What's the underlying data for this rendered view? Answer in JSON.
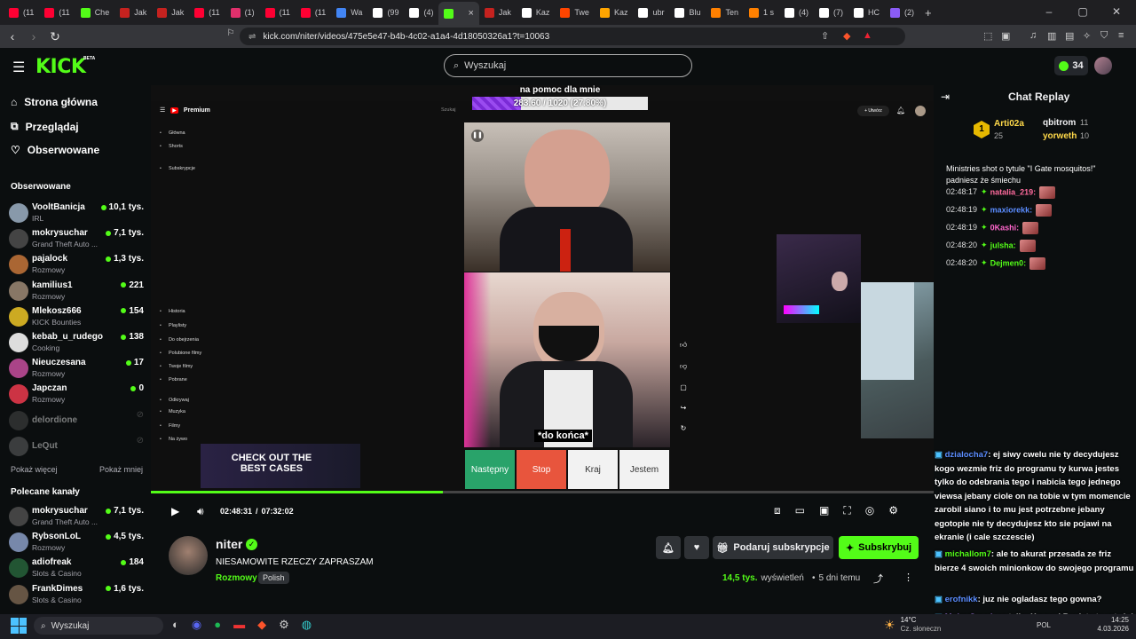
{
  "browser": {
    "tabs": [
      {
        "label": "(11",
        "color": "#ff0033"
      },
      {
        "label": "(11",
        "color": "#ff0033"
      },
      {
        "label": "Che",
        "color": "#53fc18"
      },
      {
        "label": "Jak",
        "color": "#c5221f"
      },
      {
        "label": "Jak",
        "color": "#c5221f"
      },
      {
        "label": "(11",
        "color": "#ff0033"
      },
      {
        "label": "(1)",
        "color": "#e1306c"
      },
      {
        "label": "(11",
        "color": "#ff0033"
      },
      {
        "label": "(11",
        "color": "#ff0033"
      },
      {
        "label": "Wa",
        "color": "#4285f4"
      },
      {
        "label": "(99",
        "color": "#ffffff"
      },
      {
        "label": "(4)",
        "color": "#ffffff"
      },
      {
        "label": "",
        "color": "#53fc18",
        "active": true
      },
      {
        "label": "Jak",
        "color": "#c5221f"
      },
      {
        "label": "Kaz",
        "color": "#ffffff"
      },
      {
        "label": "Twe",
        "color": "#ff4500"
      },
      {
        "label": "Kaz",
        "color": "#ffa500"
      },
      {
        "label": "ubr",
        "color": "#ffffff"
      },
      {
        "label": "Blu",
        "color": "#ffffff"
      },
      {
        "label": "Ten",
        "color": "#ff8000"
      },
      {
        "label": "1 s",
        "color": "#ff8000"
      },
      {
        "label": "(4)",
        "color": "#ffffff"
      },
      {
        "label": "(7)",
        "color": "#ffffff"
      },
      {
        "label": "HC",
        "color": "#ffffff"
      },
      {
        "label": "(2)",
        "color": "#8b5cf6"
      }
    ],
    "close_tab": "×",
    "new_tab": "+",
    "url": "kick.com/niter/videos/475e5e47-b4b-4c02-a1a4-4d18050326a1?t=10063"
  },
  "header": {
    "logo": "KICK",
    "beta": "BETA",
    "search_placeholder": "Wyszukaj",
    "coins": "34"
  },
  "sidebar": {
    "nav": [
      {
        "label": "Strona główna",
        "icon": "home-icon"
      },
      {
        "label": "Przeglądaj",
        "icon": "browse-icon"
      },
      {
        "label": "Obserwowane",
        "icon": "heart-icon"
      }
    ],
    "followed_title": "Obserwowane",
    "followed": [
      {
        "name": "VooltBanicja",
        "category": "IRL",
        "viewers": "10,1 tys.",
        "color": "#8899aa",
        "live": true
      },
      {
        "name": "mokrysuchar",
        "category": "Grand Theft Auto ...",
        "viewers": "7,1 tys.",
        "color": "#444",
        "live": true
      },
      {
        "name": "pajalock",
        "category": "Rozmowy",
        "viewers": "1,3 tys.",
        "color": "#aa6633",
        "live": true
      },
      {
        "name": "kamilius1",
        "category": "Rozmowy",
        "viewers": "221",
        "color": "#887766",
        "live": true
      },
      {
        "name": "Mlekosz666",
        "category": "KICK Bounties",
        "viewers": "154",
        "color": "#ccaa22",
        "live": true
      },
      {
        "name": "kebab_u_rudego",
        "category": "Cooking",
        "viewers": "138",
        "color": "#ddd",
        "live": true
      },
      {
        "name": "Nieuczesana",
        "category": "Rozmowy",
        "viewers": "17",
        "color": "#aa4488",
        "live": true
      },
      {
        "name": "Japczan",
        "category": "Rozmowy",
        "viewers": "0",
        "color": "#cc3344",
        "live": true
      },
      {
        "name": "delordione",
        "category": "",
        "viewers": "",
        "color": "#555",
        "live": false
      },
      {
        "name": "LeQut",
        "category": "",
        "viewers": "",
        "color": "#777",
        "live": false
      }
    ],
    "show_more": "Pokaż więcej",
    "show_less": "Pokaż mniej",
    "recommended_title": "Polecane kanały",
    "recommended": [
      {
        "name": "mokrysuchar",
        "category": "Grand Theft Auto ...",
        "viewers": "7,1 tys.",
        "color": "#444"
      },
      {
        "name": "RybsonLoL",
        "category": "Rozmowy",
        "viewers": "4,5 tys.",
        "color": "#7788aa"
      },
      {
        "name": "adiofreak",
        "category": "Slots & Casino",
        "viewers": "184",
        "color": "#225533"
      },
      {
        "name": "FrankDimes",
        "category": "Slots & Casino",
        "viewers": "1,6 tys.",
        "color": "#665544"
      }
    ]
  },
  "player": {
    "overlay_title": "na pomoc dla mnie",
    "goal": "283.60 / 1020 (27.80%)",
    "goal_fraction": 0.278,
    "subtitle": "*do końca*",
    "time_current": "02:48:31",
    "time_total": "07:32:02",
    "progress_fraction": 0.373,
    "yt_buttons": [
      "Następny",
      "Stop",
      "Kraj",
      "Jestem"
    ],
    "yt_sidebar": [
      "Główna",
      "Shorts",
      "Subskrypcje",
      "Historia",
      "Playlisty",
      "Do obejrzenia",
      "Polubione filmy",
      "Twoje filmy",
      "Pobrane",
      "Odkrywaj",
      "Muzyka",
      "Filmy",
      "Na żywo"
    ],
    "promo_title": "CHECK OUT THE BEST CASES"
  },
  "channel": {
    "name": "niter",
    "title": "NIESAMOWITE RZECZY ZAPRASZAM",
    "category": "Rozmowy",
    "language": "Polish",
    "views": "14,5 tys.",
    "views_label": "wyświetleń",
    "age": "5 dni temu",
    "gift_label": "Podaruj subskrypcje",
    "subscribe_label": "Subskrybuj"
  },
  "chat": {
    "title": "Chat Replay",
    "leader1": {
      "name": "Arti02a",
      "value": "25"
    },
    "leader2": {
      "name": "qbitrom",
      "value": "11"
    },
    "leader3": {
      "name": "yorweth",
      "value": "10"
    },
    "messages_top": [
      {
        "text": "Ministries shot o tytule \"I Gate mosquitos!\"",
        "color": "#fff"
      },
      {
        "text": "padniesz że śmiechu",
        "color": "#fff"
      },
      {
        "time": "02:48:17",
        "user": "natalia_219:",
        "ucolor": "#ff6b9d"
      },
      {
        "time": "02:48:19",
        "user": "maxiorekk:",
        "ucolor": "#5b8dff"
      },
      {
        "time": "02:48:19",
        "user": "0Kashi:",
        "ucolor": "#ff66cc"
      },
      {
        "time": "02:48:20",
        "user": "julsha:",
        "ucolor": "#53fc18"
      },
      {
        "time": "02:48:20",
        "user": "Dejmen0:",
        "ucolor": "#53fc18"
      }
    ],
    "messages_bottom": [
      {
        "user": "dzialocha7",
        "text": ": ej siwy cwelu nie ty decydujesz kogo wezmie friz do programu ty kurwa jestes tylko do odebrania tego i nabicia tego jednego viewsa jebany ciole on na tobie w tym momencie zarobil siano i to mu jest potrzebne jebany egotopie nie ty decydujesz kto sie pojawi na ekranie (i cale szczescie)",
        "ucolor": "#5b8dff"
      },
      {
        "user": "michallom7",
        "text": ": ale to akurat przesada ze friz bierze 4 swoich minionkow do swojego programu",
        "ucolor": "#53fc18"
      },
      {
        "user": "erofnikk",
        "text": ": juz nie ogladasz tego gowna?",
        "ucolor": "#5b8dff"
      },
      {
        "user": "MokrySpuchar",
        "text": ": tylko Xayoo i Bagieta to artyści reszta to nędzni rzemieślnicy",
        "ucolor": "#b388ff"
      }
    ]
  },
  "taskbar": {
    "search": "Wyszukaj",
    "temp": "14°C",
    "weather": "Cz. słoneczn",
    "lang": "POL",
    "time": "14:25",
    "date": "4.03.2026"
  }
}
